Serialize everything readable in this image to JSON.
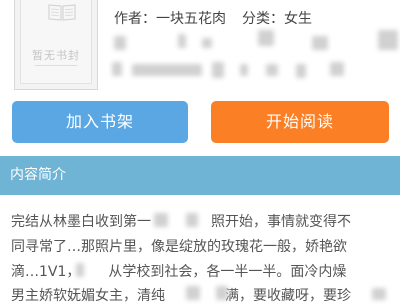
{
  "book": {
    "cover_text": "暂无书封",
    "author_label": "作者：",
    "author": "一块五花肉",
    "category_label": "分类：",
    "category": "女生"
  },
  "buttons": {
    "add_shelf": "加入书架",
    "start_read": "开始阅读"
  },
  "intro": {
    "header": "内容简介",
    "line1_a": "完结从林墨白收到第一",
    "line1_b": "照开始，事情就变得不",
    "line2": "同寻常了…那照片里，像是绽放的玫瑰花一般，娇艳欲",
    "line3_a": "滴…1V1，",
    "line3_b": "从学校到社会，各一半一半。面冷内燥",
    "line4_a": "男主娇软妩媚女主，清纯",
    "line4_b": "满，要收藏呀，要珍"
  }
}
